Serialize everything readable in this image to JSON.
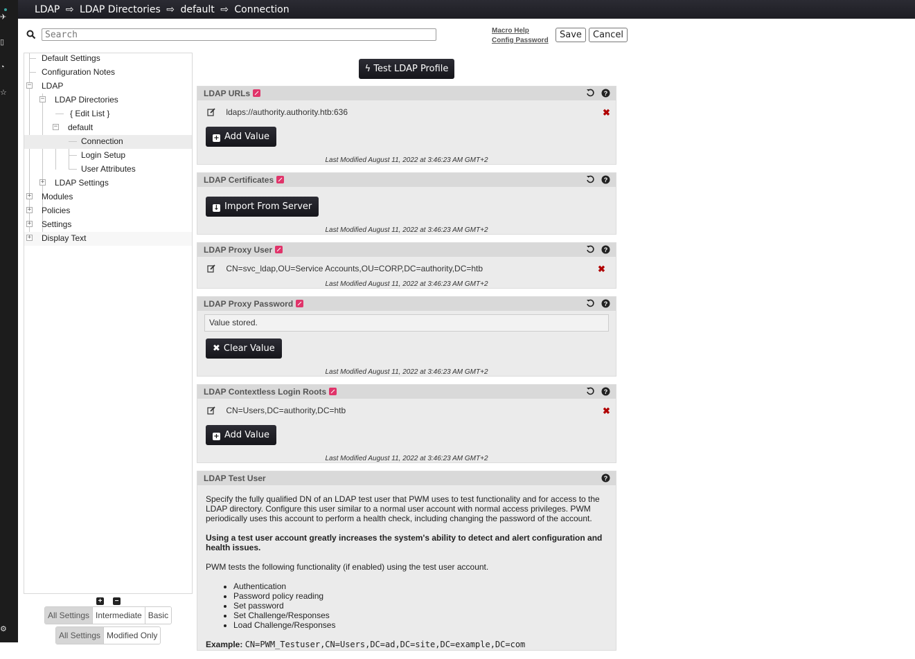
{
  "breadcrumb": {
    "items": [
      "LDAP",
      "LDAP Directories",
      "default",
      "Connection"
    ],
    "separator": "⇨"
  },
  "search": {
    "placeholder": "Search",
    "value": ""
  },
  "header_links": {
    "macro_help": "Macro Help",
    "config_password": "Config Password"
  },
  "buttons": {
    "save": "Save",
    "cancel": "Cancel",
    "test_profile": "Test LDAP Profile"
  },
  "tree": {
    "default_settings": "Default Settings",
    "configuration_notes": "Configuration Notes",
    "ldap": "LDAP",
    "ldap_directories": "LDAP Directories",
    "edit_list": "Edit List",
    "default": "default",
    "connection": "Connection",
    "login_setup": "Login Setup",
    "user_attributes": "User Attributes",
    "ldap_settings": "LDAP Settings",
    "modules": "Modules",
    "policies": "Policies",
    "settings": "Settings",
    "display_text": "Display Text"
  },
  "level_filter": {
    "options": [
      "All Settings",
      "Intermediate",
      "Basic"
    ],
    "selected": "All Settings"
  },
  "modified_filter": {
    "options": [
      "All Settings",
      "Modified Only"
    ],
    "selected": "All Settings"
  },
  "last_modified_text": "Last Modified August 11, 2022 at 3:46:23 AM GMT+2",
  "panels": {
    "ldap_urls": {
      "title": "LDAP URLs",
      "values": [
        "ldaps://authority.authority.htb:636"
      ],
      "add_label": "Add Value"
    },
    "ldap_certificates": {
      "title": "LDAP Certificates",
      "import_label": "Import From Server"
    },
    "ldap_proxy_user": {
      "title": "LDAP Proxy User",
      "value": "CN=svc_ldap,OU=Service Accounts,OU=CORP,DC=authority,DC=htb"
    },
    "ldap_proxy_password": {
      "title": "LDAP Proxy Password",
      "stored_text": "Value stored.",
      "clear_label": "Clear Value"
    },
    "ldap_login_roots": {
      "title": "LDAP Contextless Login Roots",
      "values": [
        "CN=Users,DC=authority,DC=htb"
      ],
      "add_label": "Add Value"
    },
    "ldap_test_user": {
      "title": "LDAP Test User",
      "para1": "Specify the fully qualified DN of an LDAP test user that PWM uses to test functionality and for access to the LDAP directory. Configure this user similar to a normal user account with normal access privileges. PWM periodically uses this account to perform a health check, including changing the password of the account.",
      "para2": "Using a test user account greatly increases the system's ability to detect and alert configuration and health issues.",
      "para3": "PWM tests the following functionality (if enabled) using the test user account.",
      "list": [
        "Authentication",
        "Password policy reading",
        "Set password",
        "Set Challenge/Responses",
        "Load Challenge/Responses"
      ],
      "example_label": "Example:",
      "example_value": "CN=PWM_Testuser,CN=Users,DC=ad,DC=site,DC=example,DC=com"
    }
  },
  "colors": {
    "topbar": "#1d1d23",
    "panel_header": "#d9d9d9",
    "panel_bg": "#ebebeb",
    "edit_badge": "#e0346a",
    "delete_x": "#b00000"
  },
  "icons": [
    "search-icon",
    "reset-icon",
    "help-icon",
    "edit-icon",
    "delete-icon",
    "plus-icon",
    "download-icon",
    "lightning-icon",
    "clear-icon"
  ]
}
